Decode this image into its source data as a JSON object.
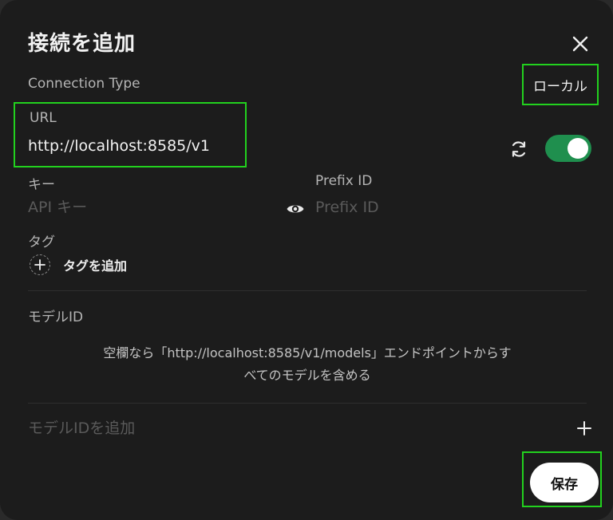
{
  "dialog": {
    "title": "接続を追加",
    "close_icon": "close-icon"
  },
  "connection_type": {
    "label": "Connection Type",
    "value": "ローカル"
  },
  "url": {
    "label": "URL",
    "value": "http://localhost:8585/v1",
    "refresh_icon": "refresh-icon",
    "enabled": true
  },
  "key": {
    "label": "キー",
    "placeholder": "API キー",
    "visibility_icon": "eye-icon"
  },
  "prefix": {
    "label": "Prefix ID",
    "placeholder": "Prefix ID"
  },
  "tags": {
    "label": "タグ",
    "add_label": "タグを追加"
  },
  "models": {
    "label": "モデルID",
    "hint_line1": "空欄なら「http://localhost:8585/v1/models」エンドポイントからす",
    "hint_line2": "べてのモデルを含める",
    "add_placeholder": "モデルIDを追加"
  },
  "footer": {
    "save_label": "保存"
  },
  "colors": {
    "highlight": "#22d11e",
    "toggle_on": "#1f8f4e",
    "background": "#1c1c1c"
  }
}
